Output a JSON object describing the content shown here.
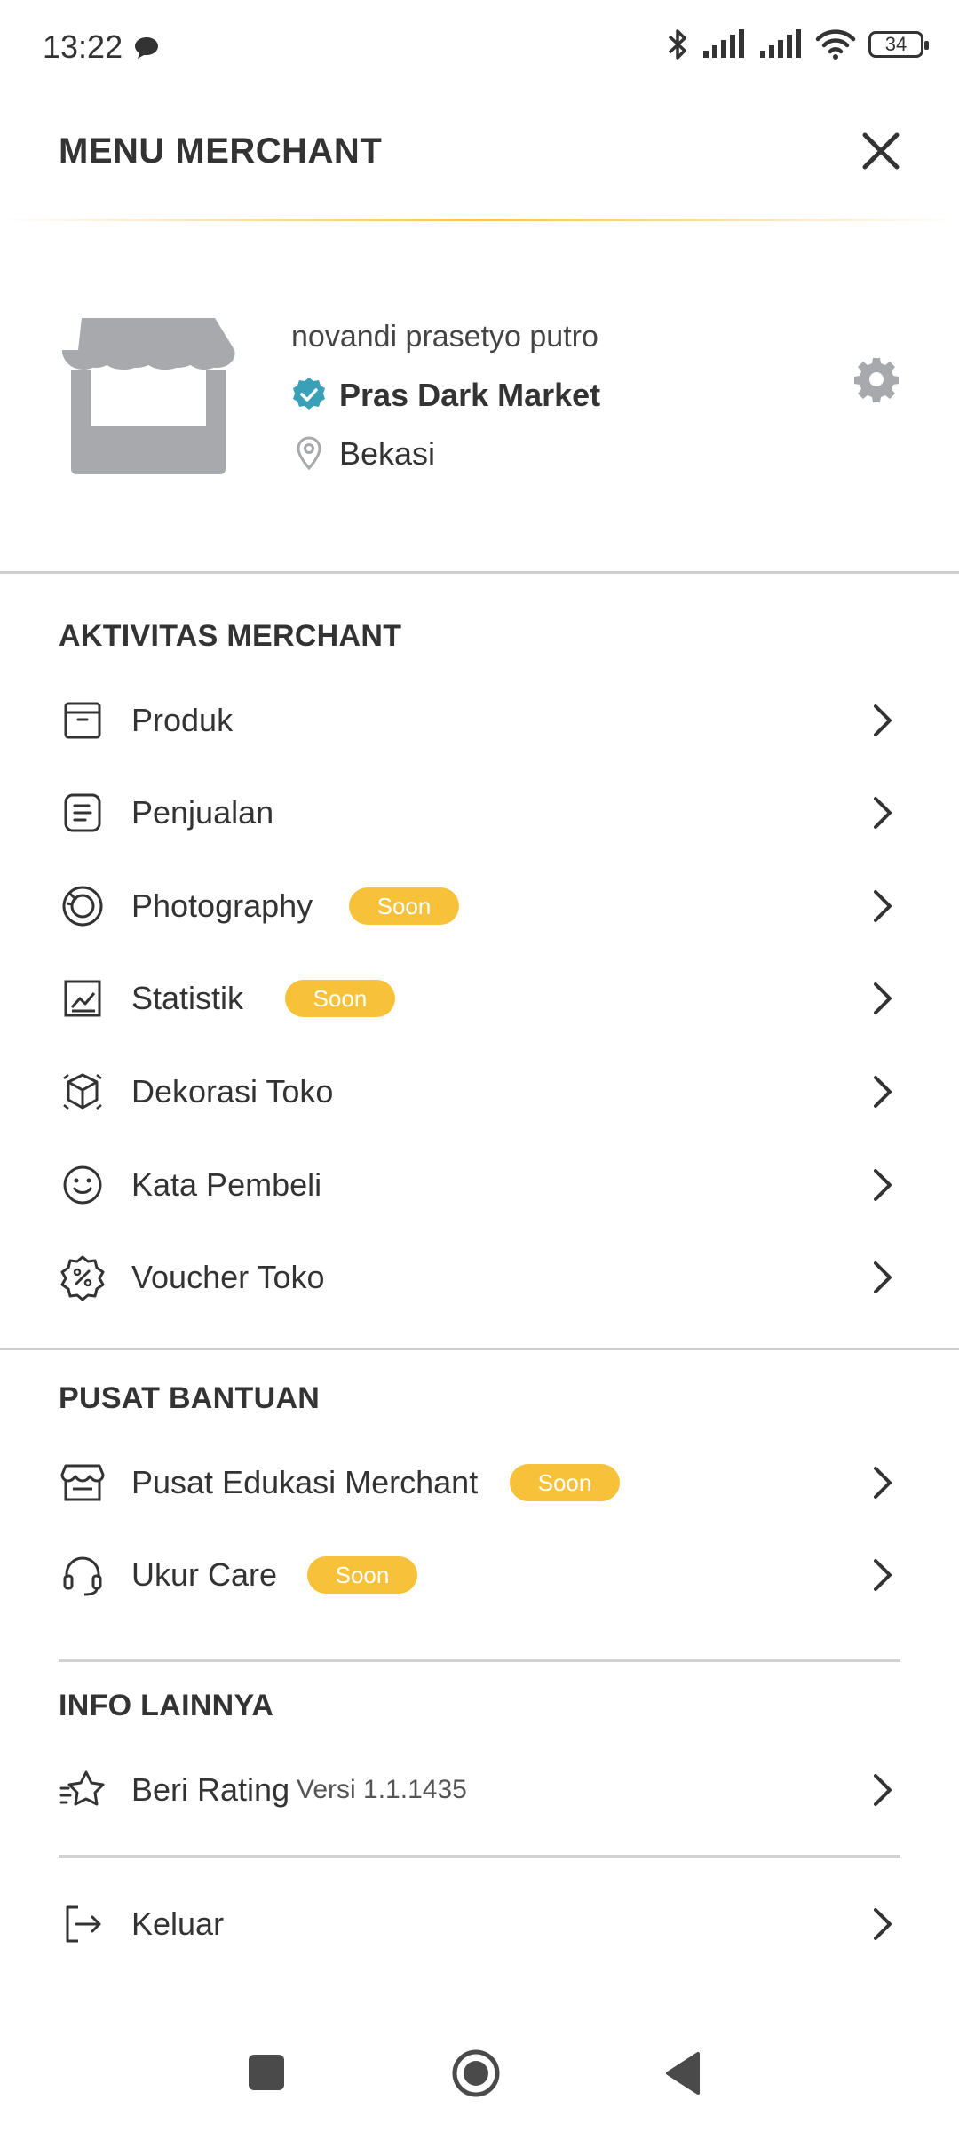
{
  "status_bar": {
    "time": "13:22",
    "battery": "34"
  },
  "header": {
    "title": "MENU MERCHANT"
  },
  "profile": {
    "owner_name": "novandi prasetyo putro",
    "store_name": "Pras Dark Market",
    "location": "Bekasi"
  },
  "sections": {
    "aktivitas": {
      "title": "AKTIVITAS MERCHANT",
      "items": [
        {
          "label": "Produk",
          "icon": "box-icon"
        },
        {
          "label": "Penjualan",
          "icon": "receipt-icon"
        },
        {
          "label": "Photography",
          "icon": "camera-lens-icon",
          "badge": "Soon"
        },
        {
          "label": "Statistik",
          "icon": "chart-icon",
          "badge": "Soon"
        },
        {
          "label": "Dekorasi Toko",
          "icon": "cube-icon"
        },
        {
          "label": "Kata Pembeli",
          "icon": "smile-icon"
        },
        {
          "label": "Voucher Toko",
          "icon": "discount-badge-icon"
        }
      ]
    },
    "bantuan": {
      "title": "PUSAT BANTUAN",
      "items": [
        {
          "label": "Pusat Edukasi Merchant",
          "icon": "store-icon",
          "badge": "Soon"
        },
        {
          "label": "Ukur Care",
          "icon": "headset-icon",
          "badge": "Soon"
        }
      ]
    },
    "info": {
      "title": "INFO LAINNYA",
      "items": [
        {
          "label": "Beri Rating",
          "icon": "star-icon",
          "version": "Versi 1.1.1435"
        }
      ]
    },
    "logout": {
      "label": "Keluar",
      "icon": "logout-icon"
    }
  },
  "colors": {
    "badge": "#f7c23a",
    "verified": "#3aa0b8",
    "icon_gray": "#a7a9ac",
    "accent_line": "#f5c15a"
  }
}
